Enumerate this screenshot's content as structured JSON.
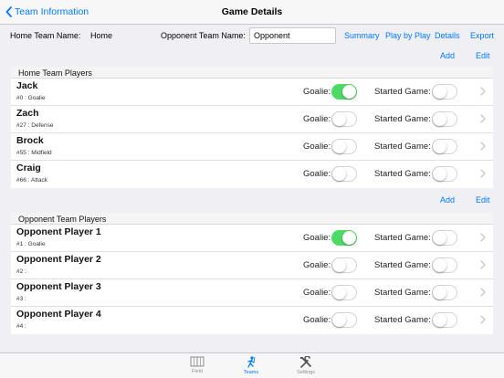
{
  "nav": {
    "back_label": "Team Information",
    "title": "Game Details"
  },
  "team_row": {
    "home_label": "Home Team Name:",
    "home_value": "Home",
    "opponent_label": "Opponent Team Name:",
    "opponent_value": "Opponent",
    "links": {
      "summary": "Summary",
      "play_by_play": "Play by Play",
      "details": "Details",
      "export": "Export"
    }
  },
  "home_actions": {
    "add": "Add",
    "edit": "Edit"
  },
  "home_section": {
    "header": "Home Team Players",
    "players": [
      {
        "name": "Jack",
        "desc": "#0 : Goalie",
        "goalie_label": "Goalie:",
        "goalie": true,
        "started_label": "Started Game:",
        "started": false
      },
      {
        "name": "Zach",
        "desc": "#27 : Defense",
        "goalie_label": "Goalie:",
        "goalie": false,
        "started_label": "Started Game:",
        "started": false
      },
      {
        "name": "Brock",
        "desc": "#55 : Midfield",
        "goalie_label": "Goalie:",
        "goalie": false,
        "started_label": "Started Game:",
        "started": false
      },
      {
        "name": "Craig",
        "desc": "#66 : Attack",
        "goalie_label": "Goalie:",
        "goalie": false,
        "started_label": "Started Game:",
        "started": false
      }
    ]
  },
  "opponent_actions": {
    "add": "Add",
    "edit": "Edit"
  },
  "opponent_section": {
    "header": "Opponent Team Players",
    "players": [
      {
        "name": "Opponent Player 1",
        "desc": "#1 : Goalie",
        "goalie_label": "Goalie:",
        "goalie": true,
        "started_label": "Started Game:",
        "started": false
      },
      {
        "name": "Opponent Player 2",
        "desc": "#2 :",
        "goalie_label": "Goalie:",
        "goalie": false,
        "started_label": "Started Game:",
        "started": false
      },
      {
        "name": "Opponent Player 3",
        "desc": "#3 :",
        "goalie_label": "Goalie:",
        "goalie": false,
        "started_label": "Started Game:",
        "started": false
      },
      {
        "name": "Opponent Player 4",
        "desc": "#4 :",
        "goalie_label": "Goalie:",
        "goalie": false,
        "started_label": "Started Game:",
        "started": false
      }
    ]
  },
  "tabbar": {
    "tabs": [
      {
        "label": "Field",
        "icon": "field-icon",
        "active": false
      },
      {
        "label": "Teams",
        "icon": "player-icon",
        "active": true
      },
      {
        "label": "Settings",
        "icon": "tools-icon",
        "active": false
      }
    ]
  },
  "colors": {
    "accent": "#007aff",
    "toggle_on": "#4cd964",
    "background": "#efeff4"
  }
}
